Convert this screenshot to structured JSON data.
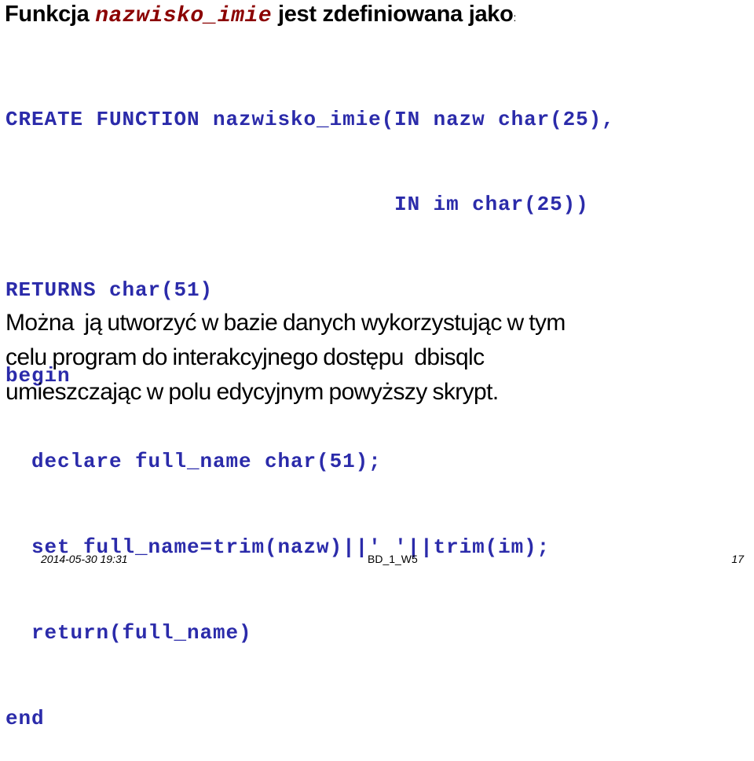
{
  "slide": {
    "title": {
      "prefix": "Funkcja ",
      "function_name": "nazwisko_imie",
      "suffix": " jest zdefiniowana jako",
      "colon": ":"
    },
    "code_lines": [
      "CREATE FUNCTION nazwisko_imie(IN nazw char(25),",
      "                              IN im char(25))",
      "RETURNS char(51)",
      "begin",
      "  declare full_name char(51);",
      "  set full_name=trim(nazw)||' '||trim(im);",
      "  return(full_name)",
      "end"
    ],
    "description_lines": [
      "Można  ją utworzyć w bazie danych wykorzystując w tym",
      "celu program do interakcyjnego dostępu  dbisqlc",
      "umieszczając w polu edycyjnym powyższy skrypt."
    ],
    "colors": {
      "code": "#2b2baa",
      "function_name": "#8b0000",
      "text": "#000000"
    }
  },
  "footer": {
    "date": "2014-05-30 19:31",
    "course": "BD_1_W5",
    "page_number": "17"
  }
}
